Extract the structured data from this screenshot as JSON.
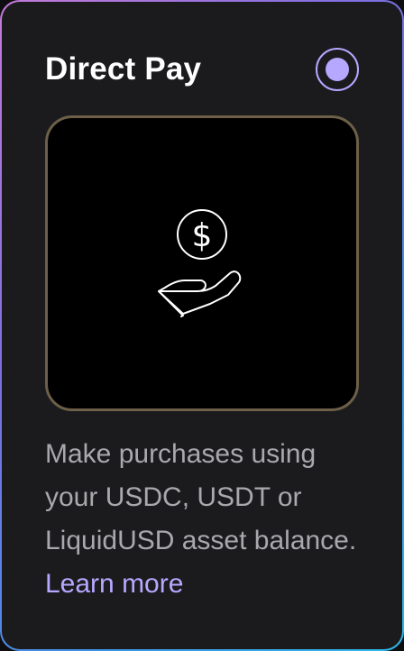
{
  "card": {
    "title": "Direct Pay",
    "selected": true,
    "illustration_icon": "hand-with-dollar-coin-icon",
    "description": "Make purchases using your USDC, USDT or LiquidUSD asset balance.",
    "link_label": "Learn more",
    "coin_symbol": "$"
  },
  "colors": {
    "accent": "#b6a8ff",
    "card_background": "#1b1b1e",
    "illustration_border": "#6d5f48",
    "description_text": "#a9a9ad"
  }
}
